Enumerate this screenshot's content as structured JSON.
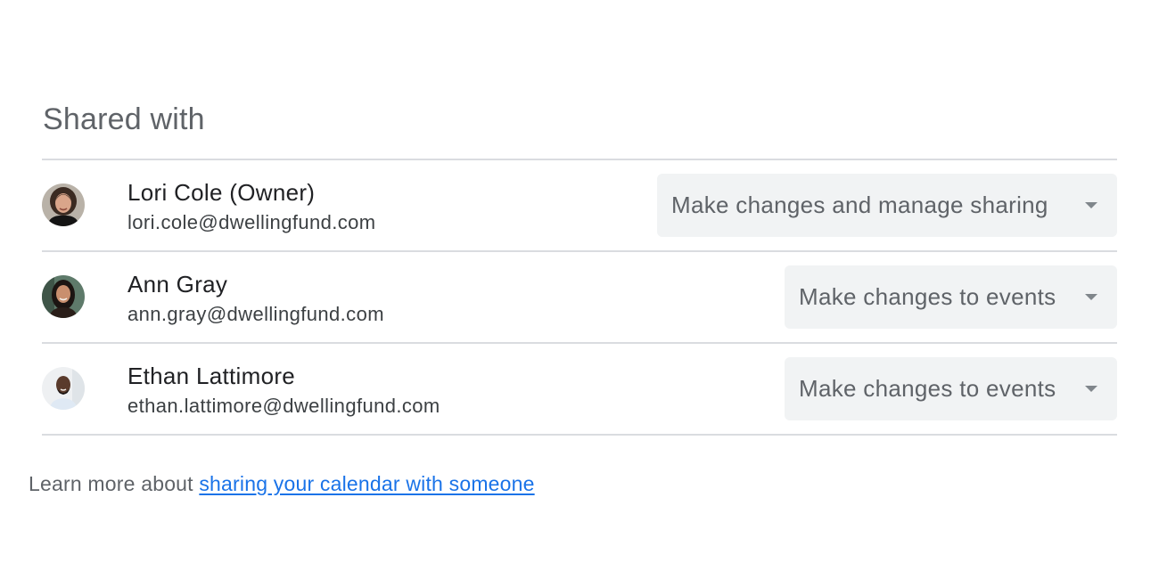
{
  "section": {
    "title": "Shared with"
  },
  "people": [
    {
      "name": "Lori Cole (Owner)",
      "email": "lori.cole@dwellingfund.com",
      "permission": "Make changes and manage sharing",
      "avatar": "woman-dark-hair-photo"
    },
    {
      "name": "Ann Gray",
      "email": "ann.gray@dwellingfund.com",
      "permission": "Make changes to events",
      "avatar": "woman-long-hair-photo"
    },
    {
      "name": "Ethan Lattimore",
      "email": "ethan.lattimore@dwellingfund.com",
      "permission": "Make changes to events",
      "avatar": "man-beard-photo"
    }
  ],
  "icons": {
    "dropdown": "caret-down-icon"
  },
  "footer": {
    "prefix": "Learn more about ",
    "link_text": "sharing your calendar with someone"
  },
  "colors": {
    "link": "#1a73e8",
    "select_background": "#f1f3f4",
    "divider": "#dadce0"
  }
}
